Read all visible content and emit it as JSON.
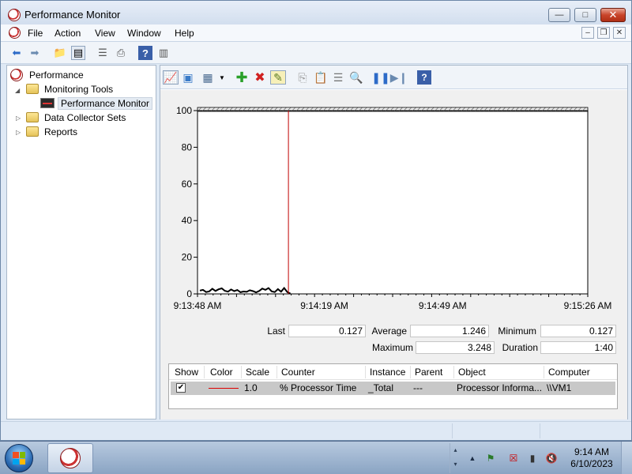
{
  "window": {
    "title": "Performance Monitor",
    "minimize_label": "—",
    "maximize_label": "□",
    "close_label": "✕"
  },
  "menu": {
    "items": [
      "File",
      "Action",
      "View",
      "Window",
      "Help"
    ],
    "mdi_minimize": "–",
    "mdi_restore": "❐",
    "mdi_close": "✕"
  },
  "tree": {
    "root": "Performance",
    "monitoring_tools": "Monitoring Tools",
    "performance_monitor": "Performance Monitor",
    "data_collector_sets": "Data Collector Sets",
    "reports": "Reports"
  },
  "stats": {
    "last_label": "Last",
    "last_value": "0.127",
    "average_label": "Average",
    "average_value": "1.246",
    "minimum_label": "Minimum",
    "minimum_value": "0.127",
    "maximum_label": "Maximum",
    "maximum_value": "3.248",
    "duration_label": "Duration",
    "duration_value": "1:40"
  },
  "legend": {
    "headers": [
      "Show",
      "Color",
      "Scale",
      "Counter",
      "Instance",
      "Parent",
      "Object",
      "Computer"
    ],
    "row": {
      "show": "✔",
      "scale": "1.0",
      "counter": "% Processor Time",
      "instance": "_Total",
      "parent": "---",
      "object": "Processor Informa...",
      "computer": "\\\\VM1"
    }
  },
  "colors": {
    "series": "#000000",
    "cursor": "#c00000",
    "legend_line": "#dd0000"
  },
  "chart_data": {
    "type": "line",
    "title": "",
    "xlabel": "",
    "ylabel": "",
    "ylim": [
      0,
      100
    ],
    "yticks": [
      0,
      20,
      40,
      60,
      80,
      100
    ],
    "xtick_labels": [
      "9:13:48 AM",
      "9:14:19 AM",
      "9:14:49 AM",
      "9:15:26 AM"
    ],
    "cursor_time": "9:14:08 AM",
    "series": [
      {
        "name": "% Processor Time",
        "values": [
          1.8,
          2.2,
          1.0,
          1.4,
          2.8,
          1.6,
          2.5,
          3.0,
          1.7,
          1.2,
          2.4,
          1.5,
          2.1,
          0.9,
          1.3,
          1.1,
          2.0,
          1.5,
          0.8,
          1.6,
          2.9,
          2.2,
          3.2,
          1.4,
          1.0,
          2.6,
          1.2,
          3.2,
          1.0,
          0.127
        ]
      }
    ]
  },
  "taskbar": {
    "clock_time": "9:14 AM",
    "clock_date": "6/10/2023",
    "tray_expand": "▲"
  }
}
